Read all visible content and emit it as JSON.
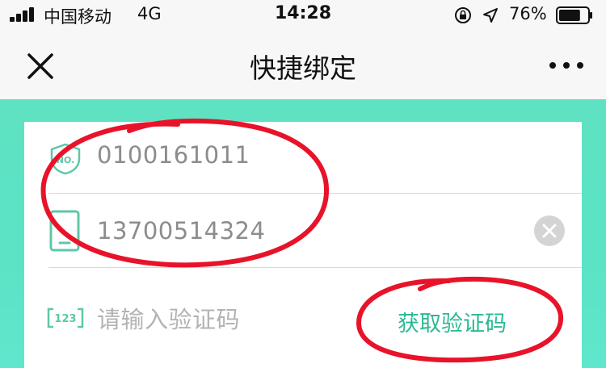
{
  "status_bar": {
    "carrier": "中国移动",
    "network": "4G",
    "time": "14:28",
    "battery": "76%",
    "battery_level": 0.76
  },
  "nav": {
    "title": "快捷绑定",
    "close_icon": "close-icon",
    "more_icon": "more-icon"
  },
  "form": {
    "account_number": "0100161011",
    "phone_number": "13700514324",
    "code_placeholder": "请输入验证码",
    "get_code_label": "获取验证码"
  },
  "colors": {
    "accent": "#2cb893",
    "icon": "#5fc7a8",
    "background_gradient": "#5ee2c1",
    "annotation": "#e8132a"
  }
}
